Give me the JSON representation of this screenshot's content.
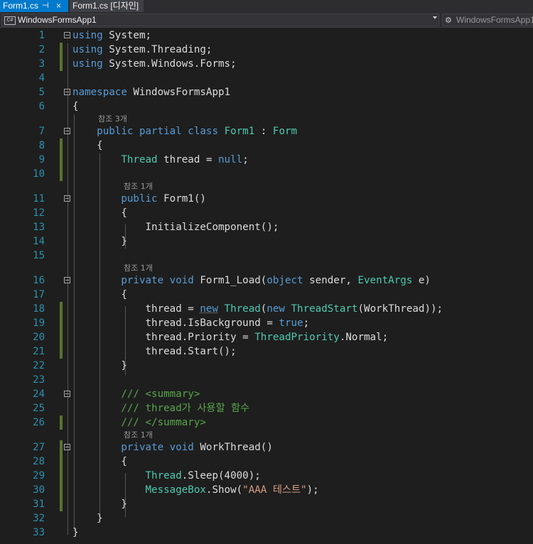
{
  "tabs": [
    {
      "label": "Form1.cs",
      "pin": "⊣",
      "close": "×"
    },
    {
      "label": "Form1.cs [디자인]"
    }
  ],
  "navbar": {
    "project": "WindowsFormsApp1",
    "class_dropdown": "WindowsFormsApp1",
    "cs_badge": "C#"
  },
  "refs": {
    "r3": "참조 3개",
    "r1a": "참조 1개",
    "r1b": "참조 1개",
    "r1c": "참조 1개"
  },
  "lines": [
    {
      "n": "1",
      "t": [
        {
          "c": "k",
          "x": "using"
        },
        {
          "c": "p",
          "x": " System;"
        }
      ]
    },
    {
      "n": "2",
      "t": [
        {
          "c": "k",
          "x": "using"
        },
        {
          "c": "p",
          "x": " System.Threading;"
        }
      ]
    },
    {
      "n": "3",
      "t": [
        {
          "c": "k",
          "x": "using"
        },
        {
          "c": "p",
          "x": " System.Windows.Forms;"
        }
      ]
    },
    {
      "n": "4",
      "t": []
    },
    {
      "n": "5",
      "t": [
        {
          "c": "k",
          "x": "namespace"
        },
        {
          "c": "p",
          "x": " WindowsFormsApp1"
        }
      ]
    },
    {
      "n": "6",
      "t": [
        {
          "c": "p",
          "x": "{"
        }
      ]
    },
    {
      "n": "7",
      "t": [
        {
          "c": "p",
          "x": "    "
        },
        {
          "c": "k",
          "x": "public partial class"
        },
        {
          "c": "p",
          "x": " "
        },
        {
          "c": "t",
          "x": "Form1"
        },
        {
          "c": "p",
          "x": " : "
        },
        {
          "c": "t",
          "x": "Form"
        }
      ]
    },
    {
      "n": "8",
      "t": [
        {
          "c": "p",
          "x": "    {"
        }
      ]
    },
    {
      "n": "9",
      "t": [
        {
          "c": "p",
          "x": "        "
        },
        {
          "c": "t",
          "x": "Thread"
        },
        {
          "c": "p",
          "x": " thread = "
        },
        {
          "c": "k",
          "x": "null"
        },
        {
          "c": "p",
          "x": ";"
        }
      ]
    },
    {
      "n": "10",
      "t": []
    },
    {
      "n": "11",
      "t": [
        {
          "c": "p",
          "x": "        "
        },
        {
          "c": "k",
          "x": "public"
        },
        {
          "c": "p",
          "x": " Form1()"
        }
      ]
    },
    {
      "n": "12",
      "t": [
        {
          "c": "p",
          "x": "        {"
        }
      ]
    },
    {
      "n": "13",
      "t": [
        {
          "c": "p",
          "x": "            InitializeComponent();"
        }
      ]
    },
    {
      "n": "14",
      "t": [
        {
          "c": "p",
          "x": "        }"
        }
      ]
    },
    {
      "n": "15",
      "t": []
    },
    {
      "n": "16",
      "t": [
        {
          "c": "p",
          "x": "        "
        },
        {
          "c": "k",
          "x": "private void"
        },
        {
          "c": "p",
          "x": " Form1_Load("
        },
        {
          "c": "k",
          "x": "object"
        },
        {
          "c": "p",
          "x": " sender, "
        },
        {
          "c": "t",
          "x": "EventArgs"
        },
        {
          "c": "p",
          "x": " e)"
        }
      ]
    },
    {
      "n": "17",
      "t": [
        {
          "c": "p",
          "x": "        {"
        }
      ]
    },
    {
      "n": "18",
      "t": [
        {
          "c": "p",
          "x": "            thread = "
        },
        {
          "c": "k u",
          "x": "new"
        },
        {
          "c": "p",
          "x": " "
        },
        {
          "c": "t",
          "x": "Thread"
        },
        {
          "c": "p",
          "x": "("
        },
        {
          "c": "k",
          "x": "new"
        },
        {
          "c": "p",
          "x": " "
        },
        {
          "c": "t",
          "x": "ThreadStart"
        },
        {
          "c": "p",
          "x": "(WorkThread));"
        }
      ]
    },
    {
      "n": "19",
      "t": [
        {
          "c": "p",
          "x": "            thread.IsBackground = "
        },
        {
          "c": "k",
          "x": "true"
        },
        {
          "c": "p",
          "x": ";"
        }
      ]
    },
    {
      "n": "20",
      "t": [
        {
          "c": "p",
          "x": "            thread.Priority = "
        },
        {
          "c": "t",
          "x": "ThreadPriority"
        },
        {
          "c": "p",
          "x": ".Normal;"
        }
      ]
    },
    {
      "n": "21",
      "t": [
        {
          "c": "p",
          "x": "            thread.Start();"
        }
      ]
    },
    {
      "n": "22",
      "t": [
        {
          "c": "p",
          "x": "        }"
        }
      ]
    },
    {
      "n": "23",
      "t": []
    },
    {
      "n": "24",
      "t": [
        {
          "c": "p",
          "x": "        "
        },
        {
          "c": "c",
          "x": "/// <summary>"
        }
      ]
    },
    {
      "n": "25",
      "t": [
        {
          "c": "p",
          "x": "        "
        },
        {
          "c": "c",
          "x": "/// thread가 사용할 함수"
        }
      ]
    },
    {
      "n": "26",
      "t": [
        {
          "c": "p",
          "x": "        "
        },
        {
          "c": "c",
          "x": "/// </summary>"
        }
      ]
    },
    {
      "n": "27",
      "t": [
        {
          "c": "p",
          "x": "        "
        },
        {
          "c": "k",
          "x": "private void"
        },
        {
          "c": "p",
          "x": " WorkThread()"
        }
      ]
    },
    {
      "n": "28",
      "t": [
        {
          "c": "p",
          "x": "        {"
        }
      ]
    },
    {
      "n": "29",
      "t": [
        {
          "c": "p",
          "x": "            "
        },
        {
          "c": "t",
          "x": "Thread"
        },
        {
          "c": "p",
          "x": ".Sleep(4000);"
        }
      ]
    },
    {
      "n": "30",
      "t": [
        {
          "c": "p",
          "x": "            "
        },
        {
          "c": "t",
          "x": "MessageBox"
        },
        {
          "c": "p",
          "x": ".Show("
        },
        {
          "c": "s",
          "x": "\"AAA 테스트\""
        },
        {
          "c": "p",
          "x": ");"
        }
      ]
    },
    {
      "n": "31",
      "t": [
        {
          "c": "p",
          "x": "        }"
        }
      ]
    },
    {
      "n": "32",
      "t": [
        {
          "c": "p",
          "x": "    }"
        }
      ]
    },
    {
      "n": "33",
      "t": [
        {
          "c": "p",
          "x": "}"
        }
      ]
    }
  ],
  "colors": {
    "keyword": "#569cd6",
    "type": "#4ec9b0",
    "comment": "#57a64a",
    "string": "#d69d85",
    "line_number": "#2b91af",
    "changed_margin": "#577430",
    "tab_active": "#007acc"
  }
}
